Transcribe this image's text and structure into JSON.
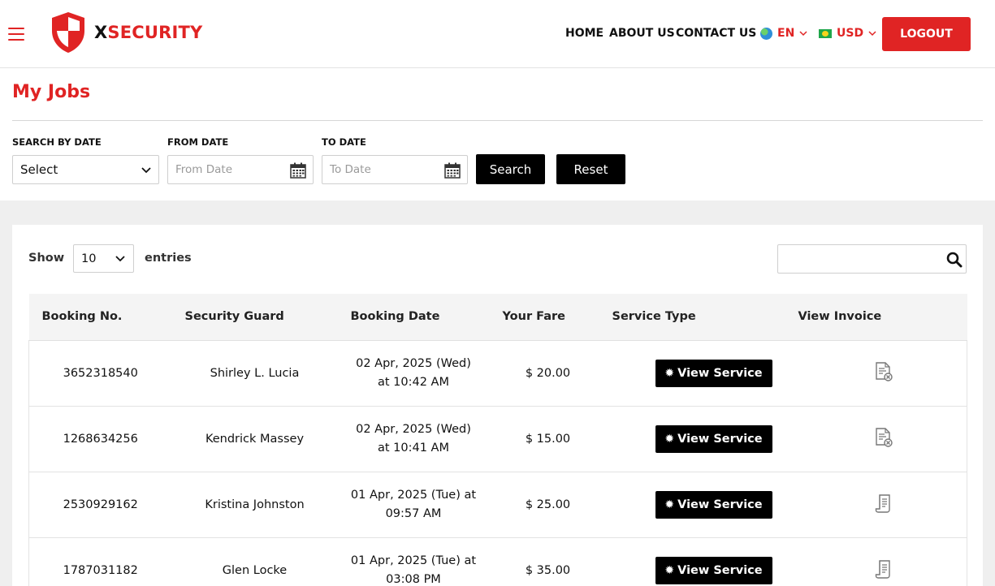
{
  "brand": {
    "name_x": "X",
    "name_rest": "SECURITY"
  },
  "nav": {
    "home": "HOME",
    "about": "ABOUT US",
    "contact": "CONTACT US"
  },
  "language": {
    "selected": "EN"
  },
  "currency": {
    "selected": "USD"
  },
  "header": {
    "logout_label": "LOGOUT"
  },
  "page": {
    "title": "My Jobs"
  },
  "filters": {
    "search_by_date_label": "SEARCH BY DATE",
    "search_by_date_value": "Select",
    "from_date_label": "FROM DATE",
    "from_date_placeholder": "From Date",
    "to_date_label": "TO DATE",
    "to_date_placeholder": "To Date",
    "search_label": "Search",
    "reset_label": "Reset"
  },
  "table_controls": {
    "show_label": "Show",
    "entries_value": "10",
    "entries_label": "entries"
  },
  "table": {
    "columns": [
      "Booking No.",
      "Security Guard",
      "Booking Date",
      "Your Fare",
      "Service Type",
      "View Invoice"
    ],
    "service_button_label": "View Service",
    "rows": [
      {
        "booking_no": "3652318540",
        "guard": "Shirley L. Lucia",
        "date_line1": "02 Apr, 2025 (Wed)",
        "date_line2": "at 10:42 AM",
        "fare": "$ 20.00",
        "invoice_icon": "cancelled-invoice-icon"
      },
      {
        "booking_no": "1268634256",
        "guard": "Kendrick Massey",
        "date_line1": "02 Apr, 2025 (Wed)",
        "date_line2": "at 10:41 AM",
        "fare": "$ 15.00",
        "invoice_icon": "cancelled-invoice-icon"
      },
      {
        "booking_no": "2530929162",
        "guard": "Kristina Johnston",
        "date_line1": "01 Apr, 2025 (Tue) at",
        "date_line2": "09:57 AM",
        "fare": "$ 25.00",
        "invoice_icon": "receipt-icon"
      },
      {
        "booking_no": "1787031182",
        "guard": "Glen Locke",
        "date_line1": "01 Apr, 2025 (Tue) at",
        "date_line2": "03:08 PM",
        "fare": "$ 35.00",
        "invoice_icon": "receipt-icon"
      }
    ]
  },
  "colors": {
    "brand_red": "#e02424",
    "button_black": "#000000",
    "panel_gray": "#efefef"
  }
}
